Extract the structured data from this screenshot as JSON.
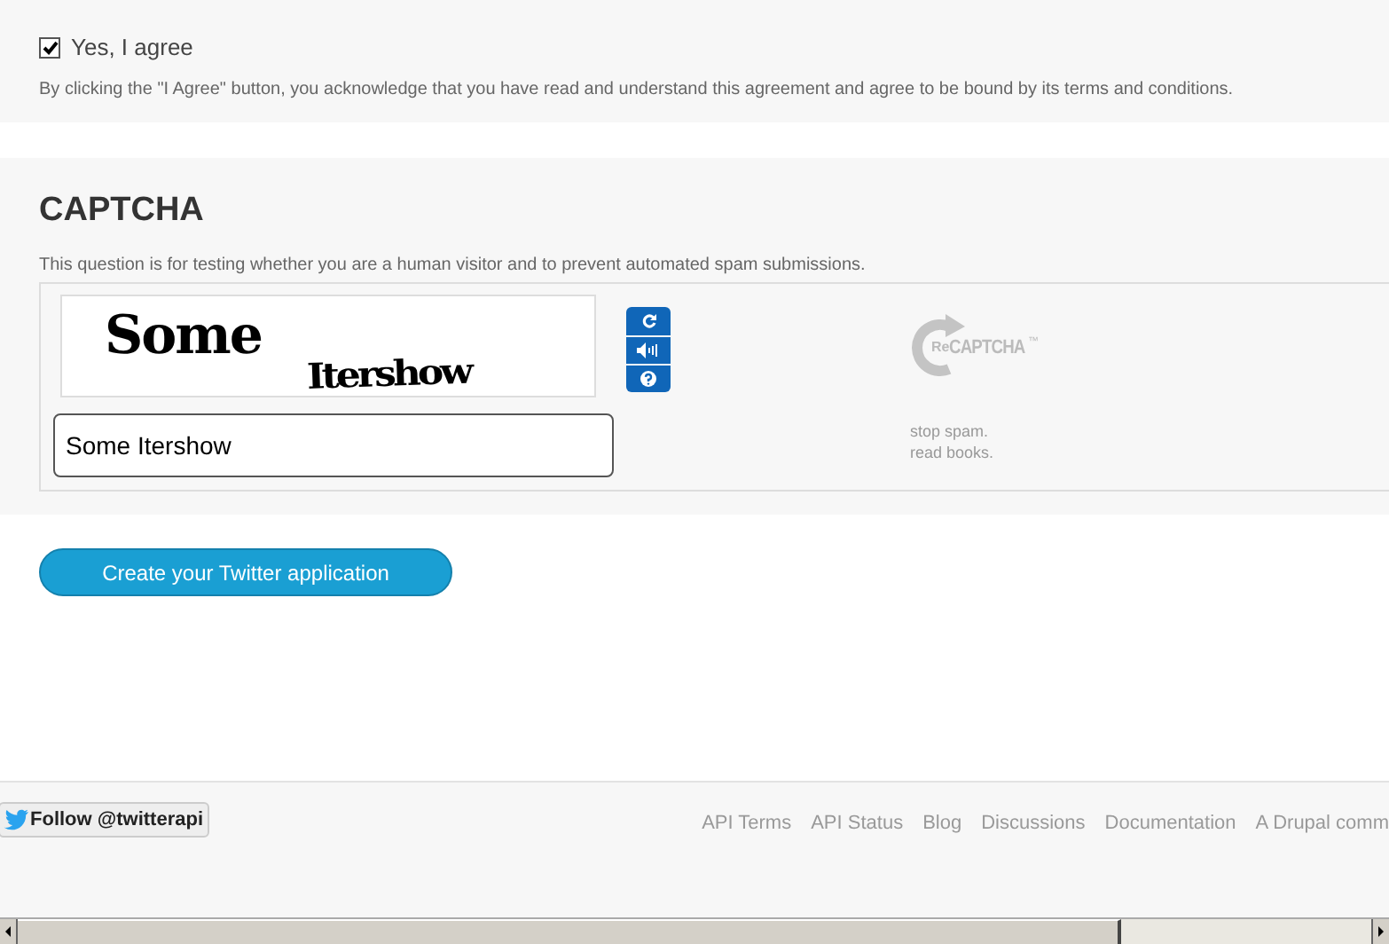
{
  "agreement": {
    "label": "Yes, I agree",
    "checked": true,
    "note": "By clicking the \"I Agree\" button, you acknowledge that you have read and understand this agreement and agree to be bound by its terms and conditions."
  },
  "captcha": {
    "title": "CAPTCHA",
    "description": "This question is for testing whether you are a human visitor and to prevent automated spam submissions.",
    "words": [
      "Some",
      "Itershow"
    ],
    "answer": "Some Itershow",
    "logo": {
      "prefix": "Re",
      "name": "CAPTCHA",
      "mark": "™"
    },
    "slogan": [
      "stop spam.",
      "read books."
    ]
  },
  "submit_button": "Create your Twitter application",
  "footer": {
    "follow_button": "Follow @twitterapi",
    "links": [
      "API Terms",
      "API Status",
      "Blog",
      "Discussions",
      "Documentation",
      "A Drupal comm"
    ]
  }
}
